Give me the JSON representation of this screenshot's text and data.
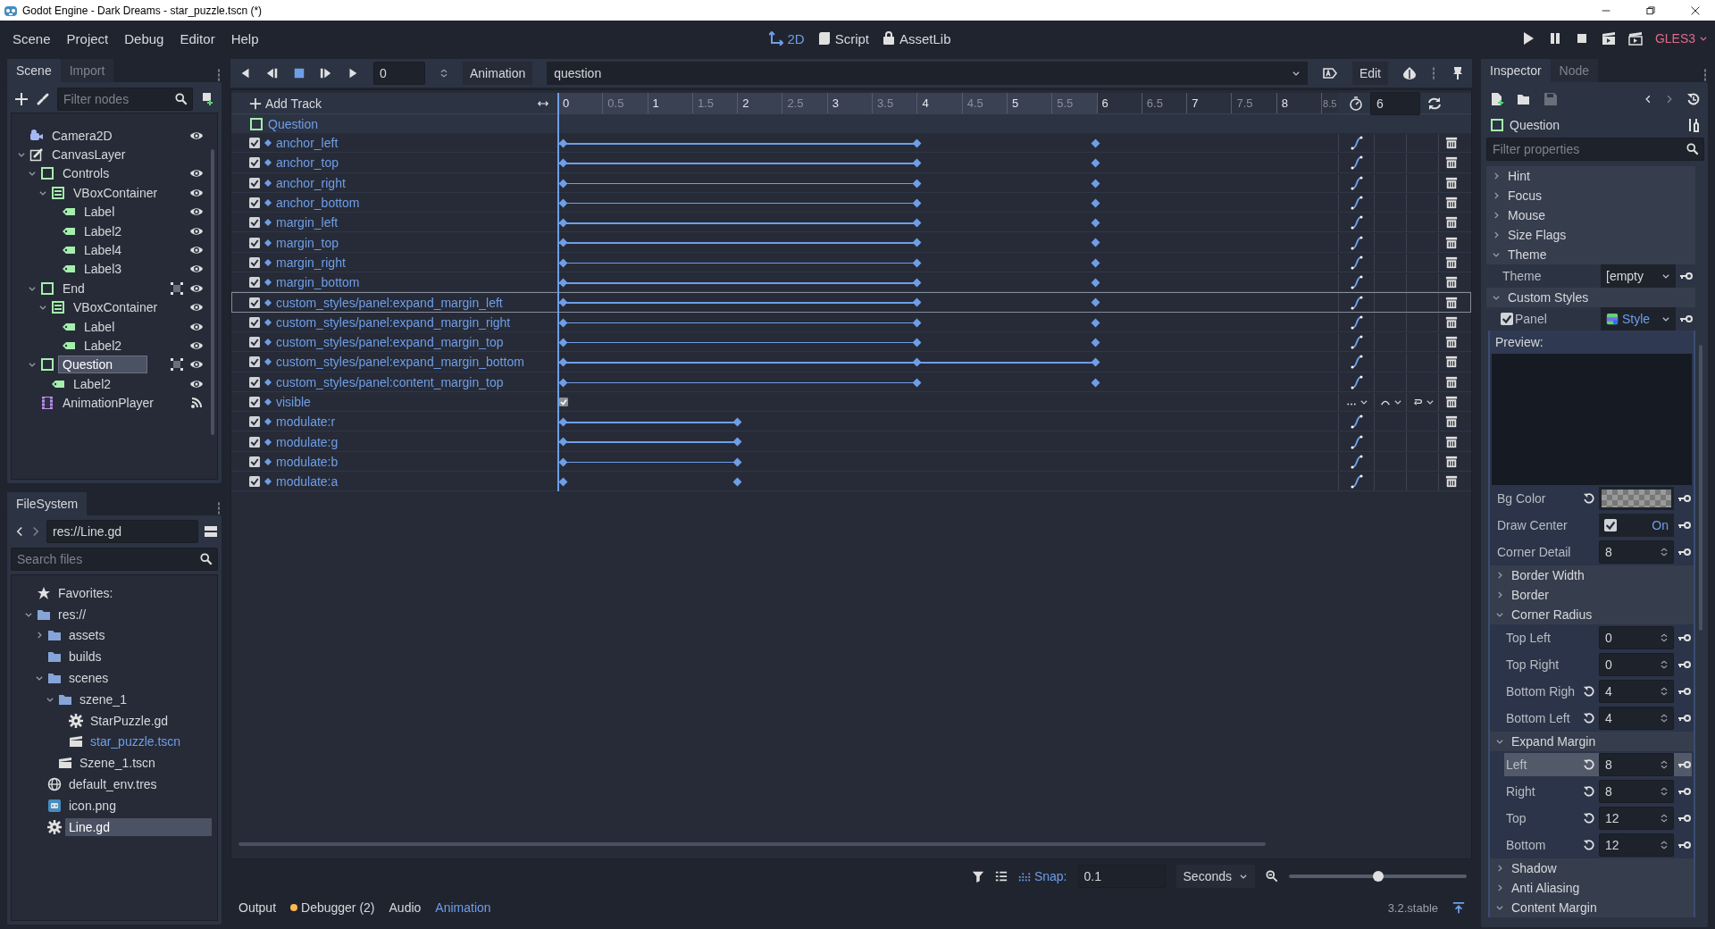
{
  "window": {
    "title": "Godot Engine - Dark Dreams - star_puzzle.tscn (*)"
  },
  "menu": [
    "Scene",
    "Project",
    "Debug",
    "Editor",
    "Help"
  ],
  "workspaces": [
    {
      "label": "2D",
      "kind": "canvas",
      "selected": true
    },
    {
      "label": "Script",
      "kind": "script",
      "selected": false
    },
    {
      "label": "AssetLib",
      "kind": "assetlib",
      "selected": false
    }
  ],
  "renderer": "GLES3",
  "scene_dock": {
    "tabs": [
      {
        "label": "Scene",
        "selected": true
      },
      {
        "label": "Import",
        "selected": false
      }
    ],
    "filter": {
      "placeholder": "Filter nodes"
    },
    "tree": [
      {
        "name": "Camera2D",
        "kind": "camera",
        "visible": true,
        "grouped": false,
        "selected": false
      },
      {
        "name": "CanvasLayer",
        "kind": "canvaslayer",
        "expanded": true,
        "grouped": false,
        "selected": false,
        "children": [
          {
            "name": "Controls",
            "kind": "control",
            "visible": true,
            "expanded": true,
            "grouped": false,
            "selected": false,
            "children": [
              {
                "name": "VBoxContainer",
                "kind": "vbox",
                "visible": true,
                "expanded": true,
                "grouped": false,
                "selected": false,
                "children": [
                  {
                    "name": "Label",
                    "kind": "label",
                    "visible": true,
                    "grouped": false,
                    "selected": false
                  },
                  {
                    "name": "Label2",
                    "kind": "label",
                    "visible": true,
                    "grouped": false,
                    "selected": false
                  },
                  {
                    "name": "Label4",
                    "kind": "label",
                    "visible": true,
                    "grouped": false,
                    "selected": false
                  },
                  {
                    "name": "Label3",
                    "kind": "label",
                    "visible": true,
                    "grouped": false,
                    "selected": false
                  }
                ]
              }
            ]
          },
          {
            "name": "End",
            "kind": "control",
            "visible": true,
            "expanded": true,
            "grouped": true,
            "selected": false,
            "children": [
              {
                "name": "VBoxContainer",
                "kind": "vbox",
                "visible": true,
                "expanded": true,
                "grouped": false,
                "selected": false,
                "children": [
                  {
                    "name": "Label",
                    "kind": "label",
                    "visible": true,
                    "grouped": false,
                    "selected": false
                  },
                  {
                    "name": "Label2",
                    "kind": "label",
                    "visible": true,
                    "grouped": false,
                    "selected": false
                  }
                ]
              }
            ]
          },
          {
            "name": "Question",
            "kind": "control",
            "visible": true,
            "expanded": true,
            "grouped": true,
            "selected": true,
            "children": [
              {
                "name": "Label2",
                "kind": "label",
                "visible": true,
                "grouped": false,
                "selected": false
              }
            ]
          },
          {
            "name": "AnimationPlayer",
            "kind": "animplayer",
            "grouped": false,
            "selected": false
          }
        ]
      }
    ]
  },
  "filesystem": {
    "tab": "FileSystem",
    "path": "res://Line.gd",
    "search": {
      "placeholder": "Search files"
    },
    "tree": [
      {
        "name": "Favorites:",
        "kind": "favorites",
        "selected": false,
        "current": false
      },
      {
        "name": "res://",
        "kind": "folder",
        "expanded": true,
        "selected": false,
        "current": false,
        "children": [
          {
            "name": "assets",
            "kind": "folder",
            "expanded": false,
            "selected": false,
            "current": false
          },
          {
            "name": "builds",
            "kind": "folder",
            "selected": false,
            "current": false
          },
          {
            "name": "scenes",
            "kind": "folder",
            "expanded": true,
            "selected": false,
            "current": false,
            "children": [
              {
                "name": "szene_1",
                "kind": "folder",
                "expanded": true,
                "selected": false,
                "current": false,
                "children": [
                  {
                    "name": "StarPuzzle.gd",
                    "kind": "script",
                    "selected": false,
                    "current": false
                  },
                  {
                    "name": "star_puzzle.tscn",
                    "kind": "scene",
                    "selected": false,
                    "current": true
                  }
                ]
              },
              {
                "name": "Szene_1.tscn",
                "kind": "scene",
                "selected": false,
                "current": false
              }
            ]
          },
          {
            "name": "default_env.tres",
            "kind": "environment",
            "selected": false,
            "current": false
          },
          {
            "name": "icon.png",
            "kind": "image",
            "selected": false,
            "current": false
          },
          {
            "name": "Line.gd",
            "kind": "script",
            "selected": true,
            "current": false
          }
        ]
      }
    ]
  },
  "animation": {
    "time": "0",
    "animation_button": "Animation",
    "current": "question",
    "edit_button": "Edit",
    "add_track": "Add Track",
    "ruler": [
      "0",
      "0.5",
      "1",
      "1.5",
      "2",
      "2.5",
      "3",
      "3.5",
      "4",
      "4.5",
      "5",
      "5.5",
      "6",
      "6.5",
      "7",
      "7.5",
      "8",
      "8.5"
    ],
    "length": "6",
    "node": "Question",
    "tracks": [
      {
        "name": "anchor_left",
        "kind": "value",
        "enabled": true,
        "selected": false,
        "level": 0.46,
        "keys": [
          {
            "level": 0
          },
          {
            "level": 0.46
          },
          {
            "level": 0.69
          }
        ]
      },
      {
        "name": "anchor_top",
        "kind": "value",
        "enabled": true,
        "selected": false,
        "level": 0.46,
        "keys": [
          {
            "level": 0
          },
          {
            "level": 0.46
          },
          {
            "level": 0.69
          }
        ]
      },
      {
        "name": "anchor_right",
        "kind": "value",
        "enabled": true,
        "selected": false,
        "level": 0.46,
        "keys": [
          {
            "level": 0
          },
          {
            "level": 0.46
          },
          {
            "level": 0.69
          }
        ]
      },
      {
        "name": "anchor_bottom",
        "kind": "value",
        "enabled": true,
        "selected": false,
        "level": 0.46,
        "keys": [
          {
            "level": 0
          },
          {
            "level": 0.46
          },
          {
            "level": 0.69
          }
        ]
      },
      {
        "name": "margin_left",
        "kind": "value",
        "enabled": true,
        "selected": false,
        "level": 0.46,
        "keys": [
          {
            "level": 0
          },
          {
            "level": 0.46
          },
          {
            "level": 0.69
          }
        ]
      },
      {
        "name": "margin_top",
        "kind": "value",
        "enabled": true,
        "selected": false,
        "level": 0.46,
        "keys": [
          {
            "level": 0
          },
          {
            "level": 0.46
          },
          {
            "level": 0.69
          }
        ]
      },
      {
        "name": "margin_right",
        "kind": "value",
        "enabled": true,
        "selected": false,
        "level": 0.46,
        "keys": [
          {
            "level": 0
          },
          {
            "level": 0.46
          },
          {
            "level": 0.69
          }
        ]
      },
      {
        "name": "margin_bottom",
        "kind": "value",
        "enabled": true,
        "selected": false,
        "level": 0.46,
        "keys": [
          {
            "level": 0
          },
          {
            "level": 0.46
          },
          {
            "level": 0.69
          }
        ]
      },
      {
        "name": "custom_styles/panel:expand_margin_left",
        "kind": "value",
        "enabled": true,
        "selected": true,
        "level": 0.46,
        "keys": [
          {
            "level": 0
          },
          {
            "level": 0.46
          },
          {
            "level": 0.69
          }
        ]
      },
      {
        "name": "custom_styles/panel:expand_margin_right",
        "kind": "value",
        "enabled": true,
        "selected": false,
        "level": 0.46,
        "keys": [
          {
            "level": 0
          },
          {
            "level": 0.46
          },
          {
            "level": 0.69
          }
        ]
      },
      {
        "name": "custom_styles/panel:expand_margin_top",
        "kind": "value",
        "enabled": true,
        "selected": false,
        "level": 0.46,
        "keys": [
          {
            "level": 0
          },
          {
            "level": 0.46
          },
          {
            "level": 0.69
          }
        ]
      },
      {
        "name": "custom_styles/panel:expand_margin_bottom",
        "kind": "value",
        "enabled": true,
        "selected": false,
        "level": 0.69,
        "keys": [
          {
            "level": 0
          },
          {
            "level": 0.46
          },
          {
            "level": 0.69
          }
        ]
      },
      {
        "name": "custom_styles/panel:content_margin_top",
        "kind": "value",
        "enabled": true,
        "selected": false,
        "level": 0.46,
        "keys": [
          {
            "level": 0
          },
          {
            "level": 0.46
          },
          {
            "level": 0.69
          }
        ]
      },
      {
        "name": "visible",
        "kind": "discrete",
        "enabled": true,
        "selected": false,
        "keys": [
          {
            "level": 0
          }
        ]
      },
      {
        "name": "modulate:r",
        "kind": "value",
        "enabled": true,
        "selected": false,
        "level": 0.23,
        "keys": [
          {
            "level": 0
          },
          {
            "level": 0.23
          }
        ]
      },
      {
        "name": "modulate:g",
        "kind": "value",
        "enabled": true,
        "selected": false,
        "level": 0.23,
        "keys": [
          {
            "level": 0
          },
          {
            "level": 0.23
          }
        ]
      },
      {
        "name": "modulate:b",
        "kind": "value",
        "enabled": true,
        "selected": false,
        "level": 0.23,
        "keys": [
          {
            "level": 0
          },
          {
            "level": 0.23
          }
        ]
      },
      {
        "name": "modulate:a",
        "kind": "value",
        "enabled": true,
        "selected": false,
        "keys": [
          {
            "level": 0
          },
          {
            "level": 0.23
          }
        ]
      }
    ],
    "snap": {
      "label": "Snap:",
      "on": true,
      "value": "0.1",
      "unit": "Seconds",
      "zoom": {
        "level": 0.5
      }
    }
  },
  "bottom_tabs": [
    {
      "label": "Output",
      "selected": false,
      "alert": false
    },
    {
      "label": "Debugger (2)",
      "selected": false,
      "alert": true
    },
    {
      "label": "Audio",
      "selected": false,
      "alert": false
    },
    {
      "label": "Animation",
      "selected": true,
      "alert": false
    }
  ],
  "version": "3.2.stable",
  "inspector": {
    "tabs": [
      {
        "label": "Inspector",
        "selected": true
      },
      {
        "label": "Node",
        "selected": false
      }
    ],
    "object": "Question",
    "filter": {
      "placeholder": "Filter properties"
    },
    "properties": [
      {
        "kind": "section",
        "label": "Hint",
        "expanded": false
      },
      {
        "kind": "section",
        "label": "Focus",
        "expanded": false
      },
      {
        "kind": "section",
        "label": "Mouse",
        "expanded": false
      },
      {
        "kind": "section",
        "label": "Size Flags",
        "expanded": false
      },
      {
        "kind": "section",
        "label": "Theme",
        "expanded": true,
        "children": [
          {
            "kind": "dropdown",
            "label": "Theme",
            "value": "[empty"
          }
        ]
      },
      {
        "kind": "section",
        "label": "Custom Styles",
        "expanded": true,
        "children": [
          {
            "kind": "resource",
            "label": "Panel",
            "checked": true,
            "value": "Style",
            "children": [
              {
                "kind": "preview",
                "label": "Preview:"
              },
              {
                "kind": "color",
                "label": "Bg Color",
                "modified": true
              },
              {
                "kind": "checkbox",
                "label": "Draw Center",
                "checked": true,
                "value": "On"
              },
              {
                "kind": "number",
                "label": "Corner Detail",
                "value": "8",
                "modified": false,
                "selected": false
              },
              {
                "kind": "section",
                "label": "Border Width",
                "expanded": false
              },
              {
                "kind": "section",
                "label": "Border",
                "expanded": false
              },
              {
                "kind": "section",
                "label": "Corner Radius",
                "expanded": true,
                "children": [
                  {
                    "kind": "number",
                    "label": "Top Left",
                    "value": "0",
                    "modified": false,
                    "selected": false
                  },
                  {
                    "kind": "number",
                    "label": "Top Right",
                    "value": "0",
                    "modified": false,
                    "selected": false
                  },
                  {
                    "kind": "number",
                    "label": "Bottom Righ",
                    "value": "4",
                    "modified": true,
                    "selected": false
                  },
                  {
                    "kind": "number",
                    "label": "Bottom Left",
                    "value": "4",
                    "modified": true,
                    "selected": false
                  }
                ]
              },
              {
                "kind": "section",
                "label": "Expand Margin",
                "expanded": true,
                "children": [
                  {
                    "kind": "number",
                    "label": "Left",
                    "value": "8",
                    "modified": true,
                    "selected": true
                  },
                  {
                    "kind": "number",
                    "label": "Right",
                    "value": "8",
                    "modified": true,
                    "selected": false
                  },
                  {
                    "kind": "number",
                    "label": "Top",
                    "value": "12",
                    "modified": true,
                    "selected": false
                  },
                  {
                    "kind": "number",
                    "label": "Bottom",
                    "value": "12",
                    "modified": true,
                    "selected": false
                  }
                ]
              },
              {
                "kind": "section",
                "label": "Shadow",
                "expanded": false
              },
              {
                "kind": "section",
                "label": "Anti Aliasing",
                "expanded": false
              },
              {
                "kind": "section",
                "label": "Content Margin",
                "expanded": true
              }
            ]
          }
        ]
      }
    ]
  }
}
